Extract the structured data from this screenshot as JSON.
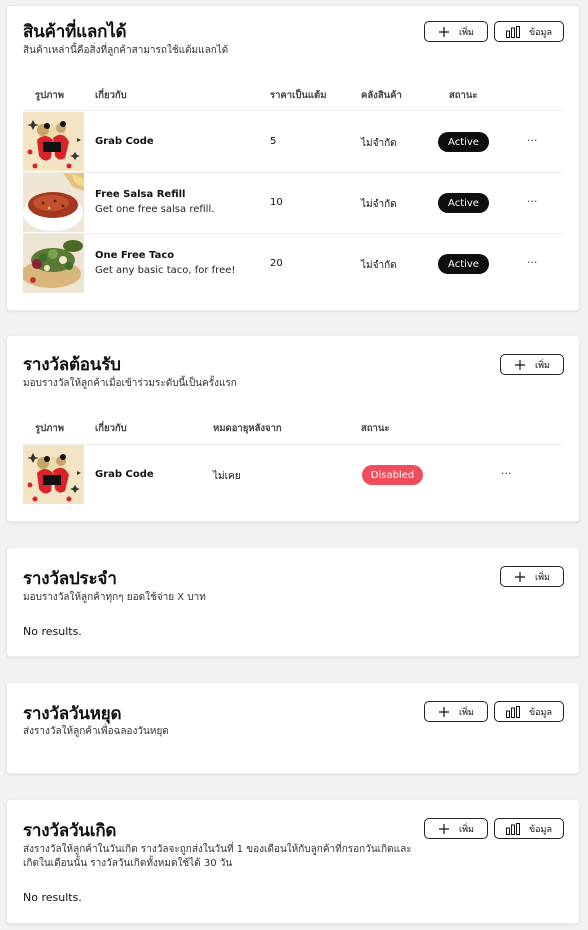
{
  "redeemable": {
    "title": "สินค้าที่แลกได้",
    "subtitle": "สินค้าเหล่านี้คือสิ่งที่ลูกค้าสามารถใช้แต้มแลกได้",
    "add_label": "เพิ่ม",
    "data_label": "ข้อมูล",
    "headers": {
      "image": "รูปภาพ",
      "about": "เกี่ยวกับ",
      "price": "ราคาเป็นแต้ม",
      "stock": "คลังสินค้า",
      "status": "สถานะ"
    },
    "rows": [
      {
        "name": "Grab Code",
        "desc": "",
        "price": "5",
        "stock": "ไม่จำกัด",
        "status": "Active",
        "image": "grab-code-illustration"
      },
      {
        "name": "Free Salsa Refill",
        "desc": "Get one free salsa refill.",
        "price": "10",
        "stock": "ไม่จำกัด",
        "status": "Active",
        "image": "salsa-bowl-photo"
      },
      {
        "name": "One Free Taco",
        "desc": "Get any basic taco, for free!",
        "price": "20",
        "stock": "ไม่จำกัด",
        "status": "Active",
        "image": "tacos-photo"
      }
    ],
    "more_label": "···"
  },
  "welcome": {
    "title": "รางวัลต้อนรับ",
    "subtitle": "มอบรางวัลให้ลูกค้าเมื่อเข้าร่วมระดับนี้เป็นครั้งแรก",
    "add_label": "เพิ่ม",
    "headers": {
      "image": "รูปภาพ",
      "about": "เกี่ยวกับ",
      "expires": "หมดอายุหลังจาก",
      "status": "สถานะ"
    },
    "rows": [
      {
        "name": "Grab Code",
        "expires": "ไม่เคย",
        "status": "Disabled",
        "image": "grab-code-illustration"
      }
    ],
    "more_label": "···"
  },
  "regular": {
    "title": "รางวัลประจำ",
    "subtitle": "มอบรางวัลให้ลูกค้าทุกๆ ยอดใช้จ่าย X บาท",
    "add_label": "เพิ่ม",
    "empty": "No results."
  },
  "holiday": {
    "title": "รางวัลวันหยุด",
    "subtitle": "ส่งรางวัลให้ลูกค้าเพื่อฉลองวันหยุด",
    "add_label": "เพิ่ม",
    "data_label": "ข้อมูล"
  },
  "birthday": {
    "title": "รางวัลวันเกิด",
    "subtitle_line1": "ส่งรางวัลให้ลูกค้าในวันเกิด รางวัลจะถูกส่งในวันที่ 1 ของเดือนให้กับลูกค้าที่กรอกวันเกิดและ",
    "subtitle_line2": "เกิดในเดือนนั้น รางวัลวันเกิดทั้งหมดใช้ได้ 30 วัน",
    "add_label": "เพิ่ม",
    "data_label": "ข้อมูล",
    "empty": "No results."
  },
  "colors": {
    "active": "#0e0e0e",
    "disabled": "#ef4d5c"
  }
}
